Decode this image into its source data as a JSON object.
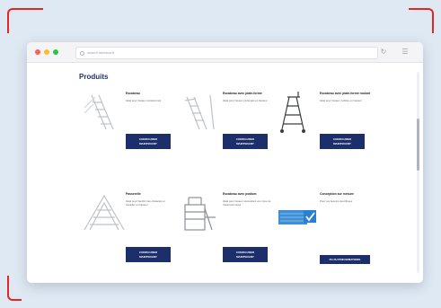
{
  "browser": {
    "url": "www.fr.tubesca.fr",
    "icons": {
      "security": "lock-icon",
      "refresh": "refresh-icon",
      "menu": "menu-icon"
    }
  },
  "page": {
    "title": "Produits"
  },
  "products": [
    {
      "name": "Escabeau",
      "description": "Idéal pour travaux occasionnels",
      "cta": "CONFIGURER\nMAINTENANT",
      "icon": "stepladder-icon"
    },
    {
      "name": "Escabeau avec plate-forme",
      "description": "Idéal pour travaux prolongés en hauteur",
      "cta": "CONFIGURER\nMAINTENANT",
      "icon": "platform-ladder-icon"
    },
    {
      "name": "Escabeau avec plate-forme roulant",
      "description": "Idéal pour travaux mobiles en hauteur",
      "cta": "CONFIGURER\nMAINTENANT",
      "icon": "rolling-platform-ladder-icon"
    },
    {
      "name": "Passerelle",
      "description": "Idéal pour franchir des obstacles et travailler en hauteur",
      "cta": "CONFIGURER\nMAINTENANT",
      "icon": "walkway-icon"
    },
    {
      "name": "Escabeau avec podium",
      "description": "Idéal pour travaux nécessitant une zone de travail plus large",
      "cta": "CONFIGURER\nMAINTENANT",
      "icon": "podium-ladder-icon"
    },
    {
      "name": "Conception sur mesure",
      "description": "Pour vos besoins spécifiques",
      "cta": "PLUS D'INFORMATIONS",
      "icon": "custom-design-icon"
    }
  ],
  "colors": {
    "accent": "#1c2f6b",
    "bracket": "#e52521",
    "background": "#dfe9f3"
  }
}
